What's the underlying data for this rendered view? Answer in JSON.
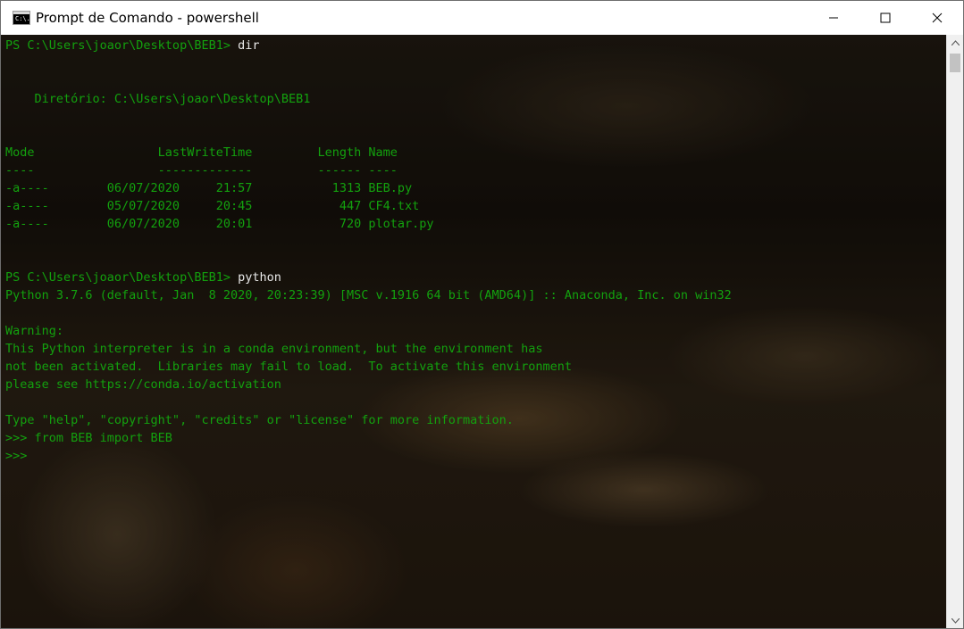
{
  "window": {
    "title": "Prompt de Comando - powershell",
    "icon_label": "C:\\.",
    "controls": [
      "minimize-icon",
      "maximize-icon",
      "close-icon"
    ]
  },
  "console": {
    "lines": [
      {
        "prompt": "PS C:\\Users\\joaor\\Desktop\\BEB1> ",
        "command": "dir"
      },
      {
        "text": ""
      },
      {
        "text": ""
      },
      {
        "text": "    Diretório: C:\\Users\\joaor\\Desktop\\BEB1"
      },
      {
        "text": ""
      },
      {
        "text": ""
      },
      {
        "text": "Mode                 LastWriteTime         Length Name"
      },
      {
        "text": "----                 -------------         ------ ----"
      },
      {
        "text": "-a----        06/07/2020     21:57           1313 BEB.py"
      },
      {
        "text": "-a----        05/07/2020     20:45            447 CF4.txt"
      },
      {
        "text": "-a----        06/07/2020     20:01            720 plotar.py"
      },
      {
        "text": ""
      },
      {
        "text": ""
      },
      {
        "prompt": "PS C:\\Users\\joaor\\Desktop\\BEB1> ",
        "command": "python"
      },
      {
        "text": "Python 3.7.6 (default, Jan  8 2020, 20:23:39) [MSC v.1916 64 bit (AMD64)] :: Anaconda, Inc. on win32"
      },
      {
        "text": ""
      },
      {
        "text": "Warning:"
      },
      {
        "text": "This Python interpreter is in a conda environment, but the environment has"
      },
      {
        "text": "not been activated.  Libraries may fail to load.  To activate this environment"
      },
      {
        "text": "please see https://conda.io/activation"
      },
      {
        "text": ""
      },
      {
        "text": "Type \"help\", \"copyright\", \"credits\" or \"license\" for more information."
      },
      {
        "text": ">>> from BEB import BEB"
      },
      {
        "text": ">>> "
      }
    ],
    "text_color": "#13a10e",
    "command_color": "#e8e8e8"
  },
  "scrollbar": {
    "up": "scroll-up-arrow-icon",
    "down": "scroll-down-arrow-icon"
  }
}
